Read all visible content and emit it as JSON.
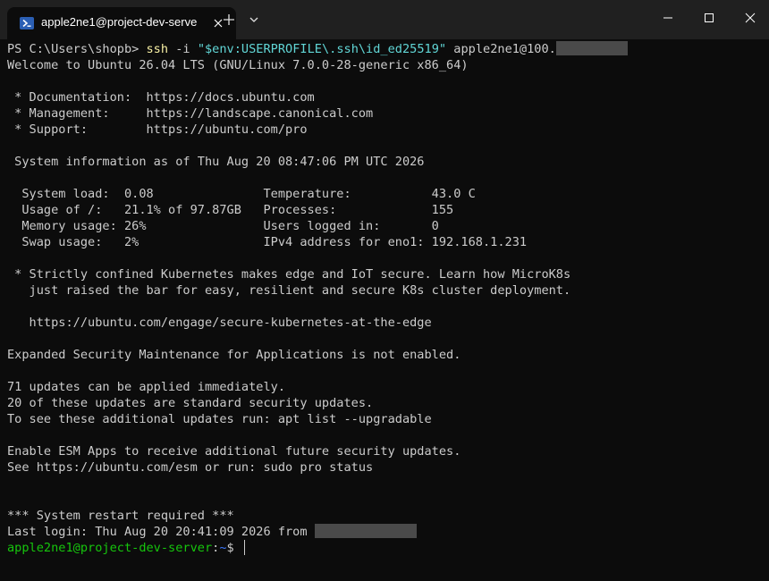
{
  "window": {
    "tab_title": "apple2ne1@project-dev-serve",
    "new_tab_label": "+"
  },
  "colors": {
    "background": "#0c0c0c",
    "titlebar": "#202020",
    "prompt_user": "#16c60c",
    "prompt_path": "#3b78ff",
    "command": "#f9f1a5",
    "string": "#61d6d6"
  },
  "terminal": {
    "ps_prompt": "PS C:\\Users\\shopb> ",
    "ssh_cmd": "ssh",
    "ssh_flag": " -i ",
    "ssh_path_a": "\"$env:USERPROFILE",
    "ssh_path_b": "\\.ssh\\id_ed25519\"",
    "ssh_host": " apple2ne1@100.",
    "welcome": "Welcome to Ubuntu 26.04 LTS (GNU/Linux 7.0.0-28-generic x86_64)",
    "doc_line": " * Documentation:  https://docs.ubuntu.com",
    "mgmt_line": " * Management:     https://landscape.canonical.com",
    "support_line": " * Support:        https://ubuntu.com/pro",
    "sysinfo": " System information as of Thu Aug 20 08:47:06 PM UTC 2026",
    "stats": [
      "  System load:  0.08               Temperature:           43.0 C",
      "  Usage of /:   21.1% of 97.87GB   Processes:             155",
      "  Memory usage: 26%                Users logged in:       0",
      "  Swap usage:   2%                 IPv4 address for eno1: 192.168.1.231"
    ],
    "k8s_1": " * Strictly confined Kubernetes makes edge and IoT secure. Learn how MicroK8s",
    "k8s_2": "   just raised the bar for easy, resilient and secure K8s cluster deployment.",
    "k8s_url": "   https://ubuntu.com/engage/secure-kubernetes-at-the-edge",
    "esm_status": "Expanded Security Maintenance for Applications is not enabled.",
    "updates_1": "71 updates can be applied immediately.",
    "updates_2": "20 of these updates are standard security updates.",
    "updates_3": "To see these additional updates run: apt list --upgradable",
    "esm_1": "Enable ESM Apps to receive additional future security updates.",
    "esm_2": "See https://ubuntu.com/esm or run: sudo pro status",
    "restart": "*** System restart required ***",
    "last_login": "Last login: Thu Aug 20 20:41:09 2026 from ",
    "prompt_user": "apple2ne1@project-dev-server",
    "prompt_sep": ":",
    "prompt_path": "~",
    "prompt_symbol": "$ "
  }
}
